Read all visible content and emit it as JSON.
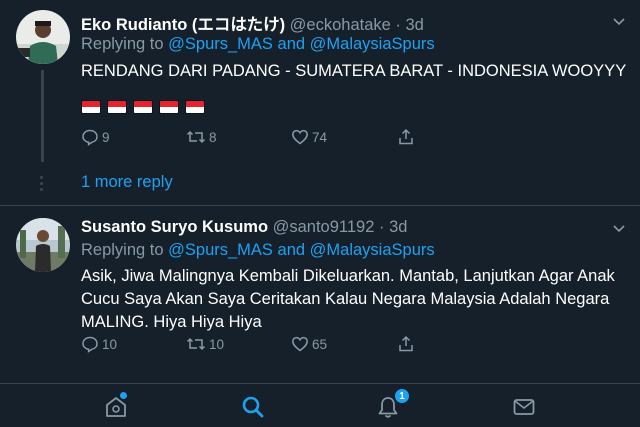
{
  "tweets": [
    {
      "name": "Eko Rudianto (エコはたけ)",
      "handle": "@eckohatake",
      "time": "· 3d",
      "replying_prefix": "Replying to",
      "mention_1": "@Spurs_MAS",
      "mention_and": "and",
      "mention_2": "@MalaysiaSpurs",
      "text": "RENDANG DARI PADANG - SUMATERA BARAT - INDONESIA WOOYYY",
      "flag_count": 5,
      "replies": "9",
      "retweets": "8",
      "likes": "74"
    },
    {
      "name": "Susanto Suryo Kusumo",
      "handle": "@santo91192",
      "time": "· 3d",
      "replying_prefix": "Replying to",
      "mention_1": "@Spurs_MAS",
      "mention_and": "and",
      "mention_2": "@MalaysiaSpurs",
      "text": "Asik, Jiwa Malingnya Kembali Dikeluarkan. Mantab, Lanjutkan Agar Anak Cucu Saya Akan Saya Ceritakan Kalau Negara Malaysia Adalah Negara MALING. Hiya Hiya Hiya",
      "replies": "10",
      "retweets": "10",
      "likes": "65"
    }
  ],
  "more_reply": "1 more reply",
  "tabbar": {
    "notification_badge": "1",
    "icons": [
      "home-icon",
      "search-icon",
      "notifications-icon",
      "messages-icon"
    ]
  },
  "colors": {
    "background": "#15202b",
    "accent": "#1da1f2",
    "muted": "#8899a6",
    "divider": "#38444d"
  }
}
